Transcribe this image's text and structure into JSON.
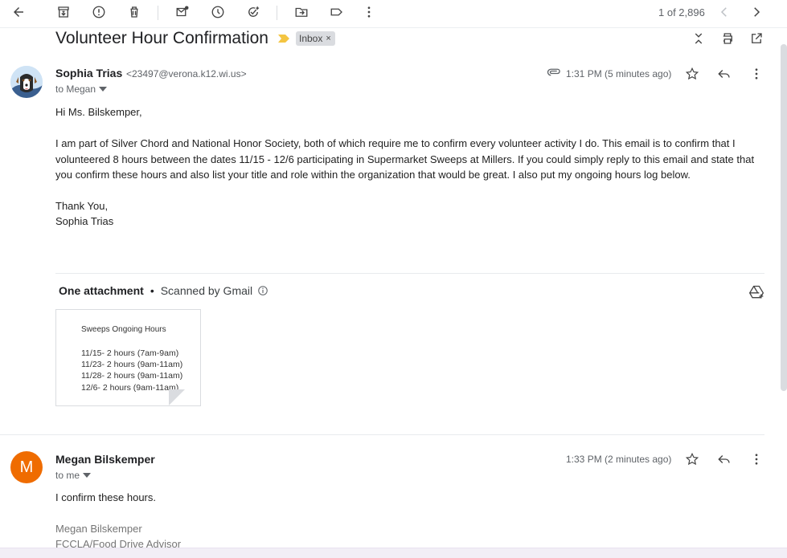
{
  "toolbar": {
    "page_count": "1 of 2,896"
  },
  "thread": {
    "subject": "Volunteer Hour Confirmation",
    "label": "Inbox",
    "label_close": "×"
  },
  "message1": {
    "sender_name": "Sophia Trias",
    "sender_email": "<23497@verona.k12.wi.us>",
    "to": "to Megan",
    "time": "1:31 PM (5 minutes ago)",
    "greeting": "Hi Ms. Bilskemper,",
    "paragraph": "I am part of Silver Chord and National Honor Society, both of which require me to confirm every volunteer activity I do. This email is to confirm that I volunteered 8 hours between the dates 11/15 - 12/6  participating in Supermarket Sweeps at Millers. If  you could simply reply to this email and state that you confirm these hours and also list your title and role within the organization that would be great. I also put my ongoing hours log below.",
    "closing": "Thank You,",
    "signature": "Sophia Trias"
  },
  "attachments": {
    "title": "One attachment",
    "dot": "•",
    "scanned": "Scanned by Gmail",
    "file": {
      "title": "Sweeps Ongoing Hours",
      "lines": [
        "11/15- 2 hours (7am-9am)",
        "11/23- 2 hours (9am-11am)",
        "11/28- 2 hours (9am-11am)",
        "12/6- 2 hours (9am-11am)"
      ]
    }
  },
  "message2": {
    "avatar_letter": "M",
    "sender_name": "Megan Bilskemper",
    "to": "to me",
    "time": "1:33 PM (2 minutes ago)",
    "body": "I confirm these hours.",
    "sig_name": "Megan Bilskemper",
    "sig_title": "FCCLA/Food Drive Advisor"
  },
  "colors": {
    "avatar_megan": "#ef6c00",
    "importance_marker": "#f4c542",
    "label_chip": "#dadce0"
  }
}
